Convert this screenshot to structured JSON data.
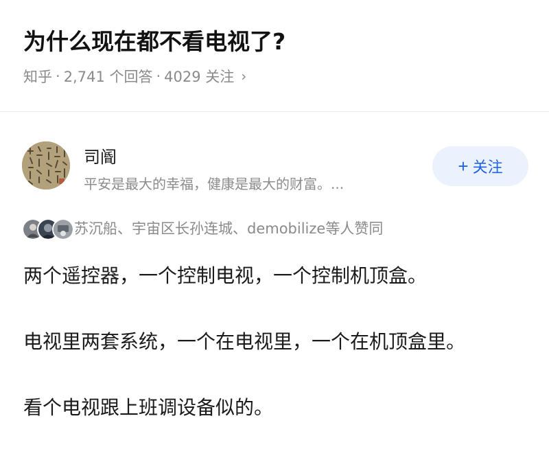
{
  "question": {
    "title": "为什么现在都不看电视了?",
    "site": "知乎",
    "dot": "·",
    "answers_count": "2,741 个回答",
    "followers_count": "4029 关注",
    "chevron": "›"
  },
  "author": {
    "name": "司阍",
    "bio": "平安是最大的幸福，健康是最大的财富。...",
    "avatar_icon": "calligraphy-avatar"
  },
  "follow_button": {
    "plus": "+",
    "label": "关注",
    "color": "#1f64e0",
    "background": "#ebf2fd"
  },
  "voters": {
    "text": "苏沉船、宇宙区长孙连城、demobilize等人赞同",
    "avatar_icons": [
      "voter-avatar-1",
      "voter-avatar-2",
      "voter-avatar-3"
    ]
  },
  "answer": {
    "paragraphs": [
      "两个遥控器，一个控制电视，一个控制机顶盒。",
      "电视里两套系统，一个在电视里，一个在机顶盒里。",
      "看个电视跟上班调设备似的。"
    ]
  }
}
